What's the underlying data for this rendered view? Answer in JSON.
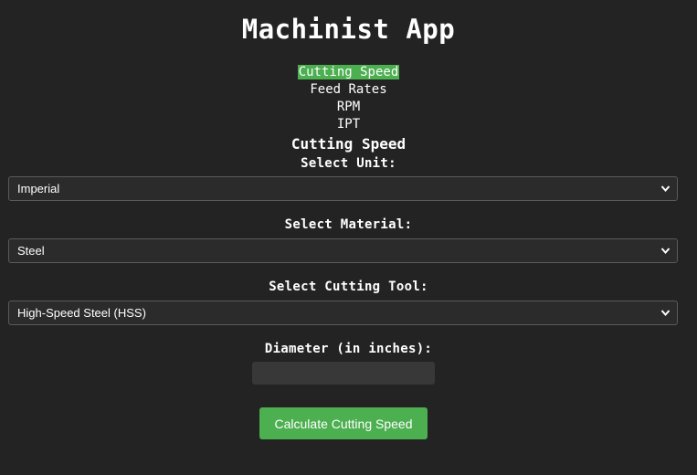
{
  "app": {
    "title": "Machinist App"
  },
  "nav": {
    "items": [
      {
        "label": "Cutting Speed",
        "active": true
      },
      {
        "label": "Feed Rates",
        "active": false
      },
      {
        "label": "RPM",
        "active": false
      },
      {
        "label": "IPT",
        "active": false
      }
    ]
  },
  "section": {
    "title": "Cutting Speed"
  },
  "form": {
    "unit": {
      "label": "Select Unit:",
      "selected": "Imperial"
    },
    "material": {
      "label": "Select Material:",
      "selected": "Steel"
    },
    "tool": {
      "label": "Select Cutting Tool:",
      "selected": "High-Speed Steel (HSS)"
    },
    "diameter": {
      "label": "Diameter (in inches):",
      "value": ""
    },
    "submit_label": "Calculate Cutting Speed"
  },
  "colors": {
    "background": "#232323",
    "accent": "#4caf50",
    "field_border": "#5a5a5a"
  },
  "icons": {
    "select_arrow": "chevron-down-icon"
  }
}
